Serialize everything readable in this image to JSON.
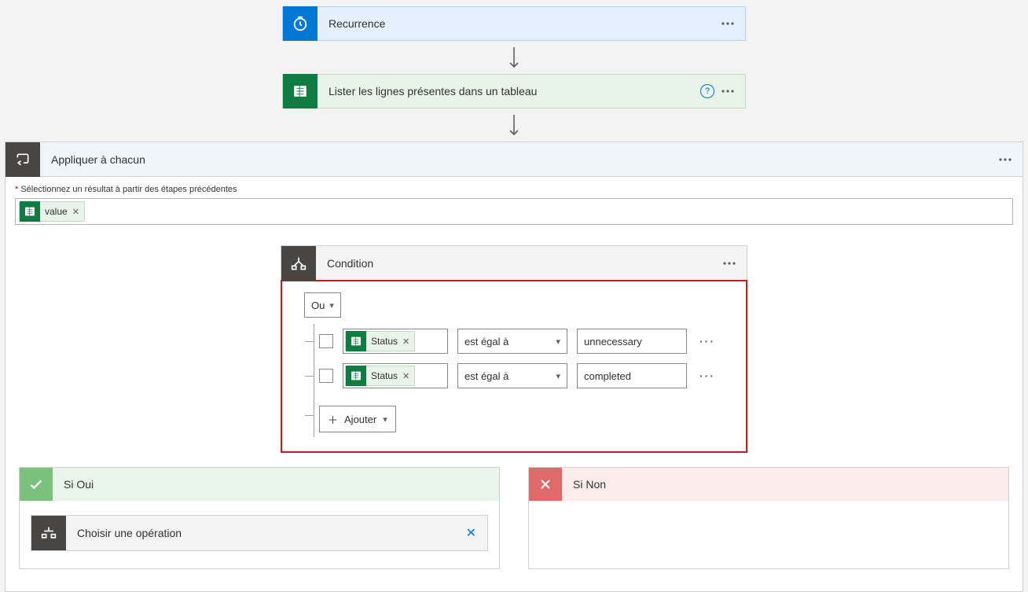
{
  "recurrence": {
    "title": "Recurrence"
  },
  "list_rows": {
    "title": "Lister les lignes présentes dans un tableau"
  },
  "apply_each": {
    "title": "Appliquer à chacun",
    "select_label": "Sélectionnez un résultat à partir des étapes précédentes",
    "token": "value"
  },
  "condition": {
    "title": "Condition",
    "logic": "Ou",
    "rows": [
      {
        "field": "Status",
        "operator": "est égal à",
        "value": "unnecessary"
      },
      {
        "field": "Status",
        "operator": "est égal à",
        "value": "completed"
      }
    ],
    "add_label": "Ajouter"
  },
  "branches": {
    "yes_title": "Si Oui",
    "no_title": "Si Non",
    "choose_op": "Choisir une opération"
  }
}
